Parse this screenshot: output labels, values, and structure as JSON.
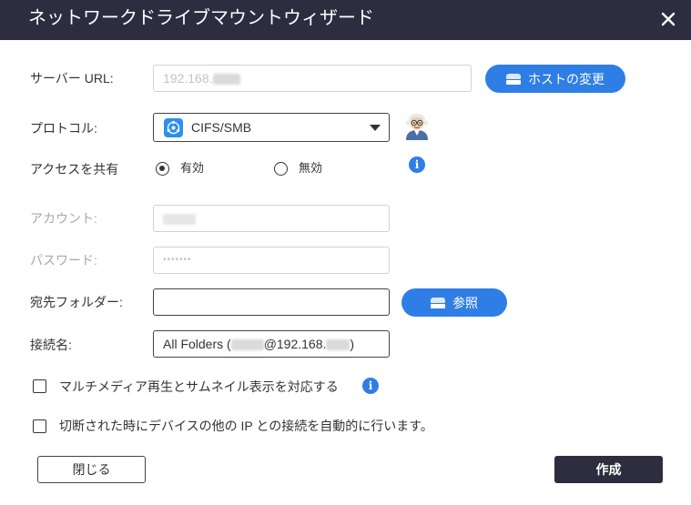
{
  "window": {
    "title": "ネットワークドライブマウントウィザード"
  },
  "server": {
    "label": "サーバー URL:",
    "value_prefix": "192.168.",
    "change_host_label": "ホストの変更"
  },
  "protocol": {
    "label": "プロトコル:",
    "selected": "CIFS/SMB"
  },
  "share_access": {
    "label": "アクセスを共有",
    "options": [
      "有効",
      "無効"
    ],
    "selected": "有効"
  },
  "account": {
    "label": "アカウント:"
  },
  "password": {
    "label": "パスワード:",
    "masked": "•••••••"
  },
  "destination": {
    "label": "宛先フォルダー:",
    "browse_label": "参照"
  },
  "connection_name": {
    "label": "接続名:",
    "prefix": "All Folders (",
    "middle": "@192.168.",
    "suffix": ")"
  },
  "options": {
    "multimedia": {
      "label": "マルチメディア再生とサムネイル表示を対応する",
      "checked": false
    },
    "reconnect": {
      "label": "切断された時にデバイスの他の IP との接続を自動的に行います。",
      "checked": false
    }
  },
  "footer": {
    "close_label": "閉じる",
    "create_label": "作成"
  },
  "colors": {
    "titlebar": "#2e2d3f",
    "accent": "#2f7ee6",
    "create_button": "#2e2d3f"
  },
  "icons": {
    "close": "close-icon",
    "storage": "storage-icon",
    "protocol": "smb-icon",
    "avatar": "helper-avatar-icon",
    "info": "info-icon"
  }
}
